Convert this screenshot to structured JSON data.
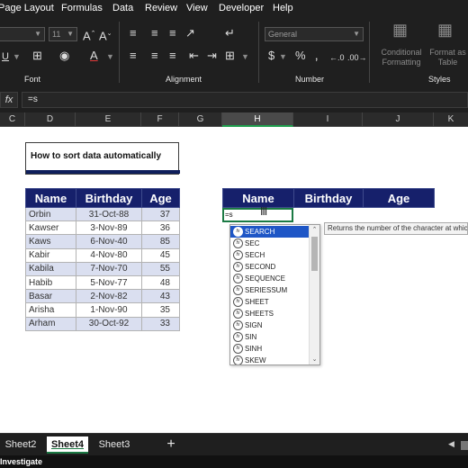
{
  "menu": [
    "Page Layout",
    "Formulas",
    "Data",
    "Review",
    "View",
    "Developer",
    "Help"
  ],
  "ribbon": {
    "font_size": "11",
    "font_group": "Font",
    "alignment_group": "Alignment",
    "number_group": "Number",
    "number_format": "General",
    "styles_group": "Styles",
    "conditional_formatting": [
      "Conditional",
      "Formatting"
    ],
    "format_as_table": [
      "Format as",
      "Table"
    ]
  },
  "formula_bar": {
    "fx": "fx",
    "value": "=s"
  },
  "columns": [
    "C",
    "D",
    "E",
    "F",
    "G",
    "H",
    "I",
    "J",
    "K"
  ],
  "selected_column": "H",
  "title_text": "How to sort data automatically",
  "source_table": {
    "headers": [
      "Name",
      "Birthday",
      "Age"
    ],
    "rows": [
      [
        "Orbin",
        "31-Oct-88",
        "37"
      ],
      [
        "Kawser",
        "3-Nov-89",
        "36"
      ],
      [
        "Kaws",
        "6-Nov-40",
        "85"
      ],
      [
        "Kabir",
        "4-Nov-80",
        "45"
      ],
      [
        "Kabila",
        "7-Nov-70",
        "55"
      ],
      [
        "Habib",
        "5-Nov-77",
        "48"
      ],
      [
        "Basar",
        "2-Nov-82",
        "43"
      ],
      [
        "Arisha",
        "1-Nov-90",
        "35"
      ],
      [
        "Arham",
        "30-Oct-92",
        "33"
      ]
    ]
  },
  "target_table": {
    "headers": [
      "Name",
      "Birthday",
      "Age"
    ]
  },
  "active_cell_text": "=s",
  "autocomplete": {
    "icon_label": "fx",
    "items": [
      "SEARCH",
      "SEC",
      "SECH",
      "SECOND",
      "SEQUENCE",
      "SERIESSUM",
      "SHEET",
      "SHEETS",
      "SIGN",
      "SIN",
      "SINH",
      "SKEW"
    ],
    "selected": "SEARCH",
    "tooltip": "Returns the number of the character at which a specific character or text string is first found"
  },
  "sheet_tabs": [
    "Sheet2",
    "Sheet4",
    "Sheet3"
  ],
  "active_tab": "Sheet4",
  "add_sheet": "+",
  "status_text": "Investigate"
}
